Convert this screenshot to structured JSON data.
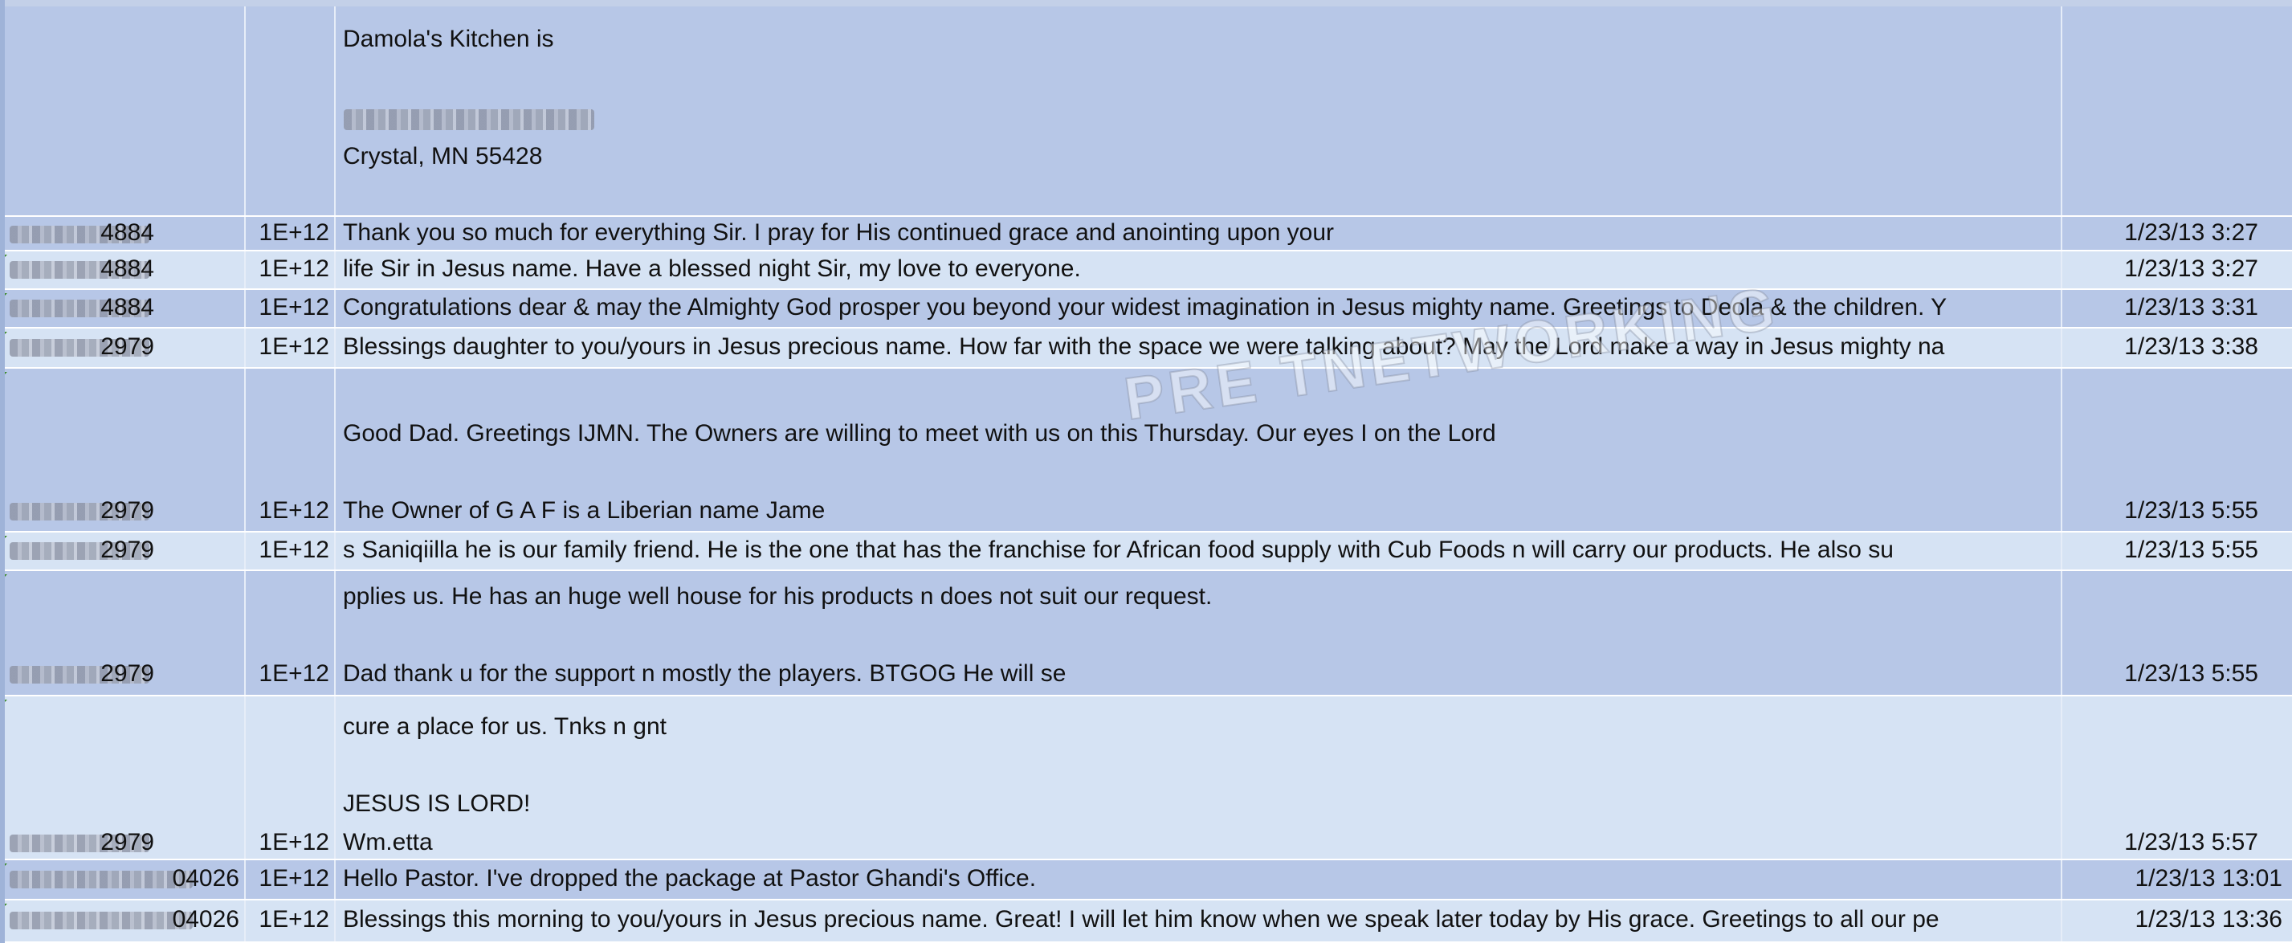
{
  "sheet": {
    "rows": [
      {
        "type": "address",
        "lines": [
          "Damola's Kitchen is",
          "",
          "Crystal, MN 55428"
        ]
      },
      {
        "phone_suffix": "4884",
        "num": "1E+12",
        "message": "Thank you so much for everything Sir. I pray for His continued grace and anointing upon your",
        "date": "1/23/13 3:27"
      },
      {
        "phone_suffix": "4884",
        "num": "1E+12",
        "message": "life Sir in Jesus name. Have a blessed night Sir, my love to everyone.",
        "date": "1/23/13 3:27"
      },
      {
        "phone_suffix": "4884",
        "num": "1E+12",
        "message": "Congratulations dear & may the Almighty God prosper you beyond your widest imagination in Jesus mighty name. Greetings to Deola & the children. Y",
        "date": "1/23/13 3:31"
      },
      {
        "phone_suffix": "2979",
        "num": "1E+12",
        "message": "Blessings daughter to you/yours in Jesus precious name. How far with the space we were talking about? May the Lord make a way in Jesus mighty na",
        "date": "1/23/13 3:38"
      },
      {
        "phone_suffix": "2979",
        "num": "1E+12",
        "message_lines": [
          "Good Dad. Greetings IJMN.   The Owners are willing to meet with us on this Thursday. Our eyes I on the Lord",
          "",
          "The Owner  of G A  F is a Liberian name Jame"
        ],
        "date": "1/23/13 5:55"
      },
      {
        "phone_suffix": "2979",
        "num": "1E+12",
        "message": "s Saniqiilla he is our family friend. He is the one that has the franchise for African food supply with Cub Foods  n will carry our products.  He also su",
        "date": "1/23/13 5:55"
      },
      {
        "phone_suffix": "2979",
        "num": "1E+12",
        "message_lines": [
          "pplies us. He has an huge well house for his products  n does not suit our request.",
          "",
          "Dad thank u for the support n mostly the players.  BTGOG He will se"
        ],
        "date": "1/23/13 5:55"
      },
      {
        "phone_suffix": "2979",
        "num": "1E+12",
        "message_lines": [
          "cure a place for us. Tnks n gnt",
          "",
          "JESUS IS LORD!",
          "Wm.etta"
        ],
        "date": "1/23/13 5:57"
      },
      {
        "phone_suffix": "04026",
        "num": "1E+12",
        "message": "Hello Pastor. I've dropped the package at Pastor Ghandi's Office.",
        "date": "1/23/13 13:01"
      },
      {
        "phone_suffix": "04026",
        "num": "1E+12",
        "message": "Blessings this morning to you/yours in Jesus precious name. Great! I will let him know when we speak later today by His grace. Greetings to all our pe",
        "date": "1/23/13 13:36"
      }
    ]
  },
  "watermark": "PRE TNETWORKING",
  "colors": {
    "row_dark": "#b7c7e7",
    "row_light": "#d6e3f4",
    "gridline": "#ffffff",
    "text": "#111111",
    "cell_marker": "#3c8a2b"
  }
}
